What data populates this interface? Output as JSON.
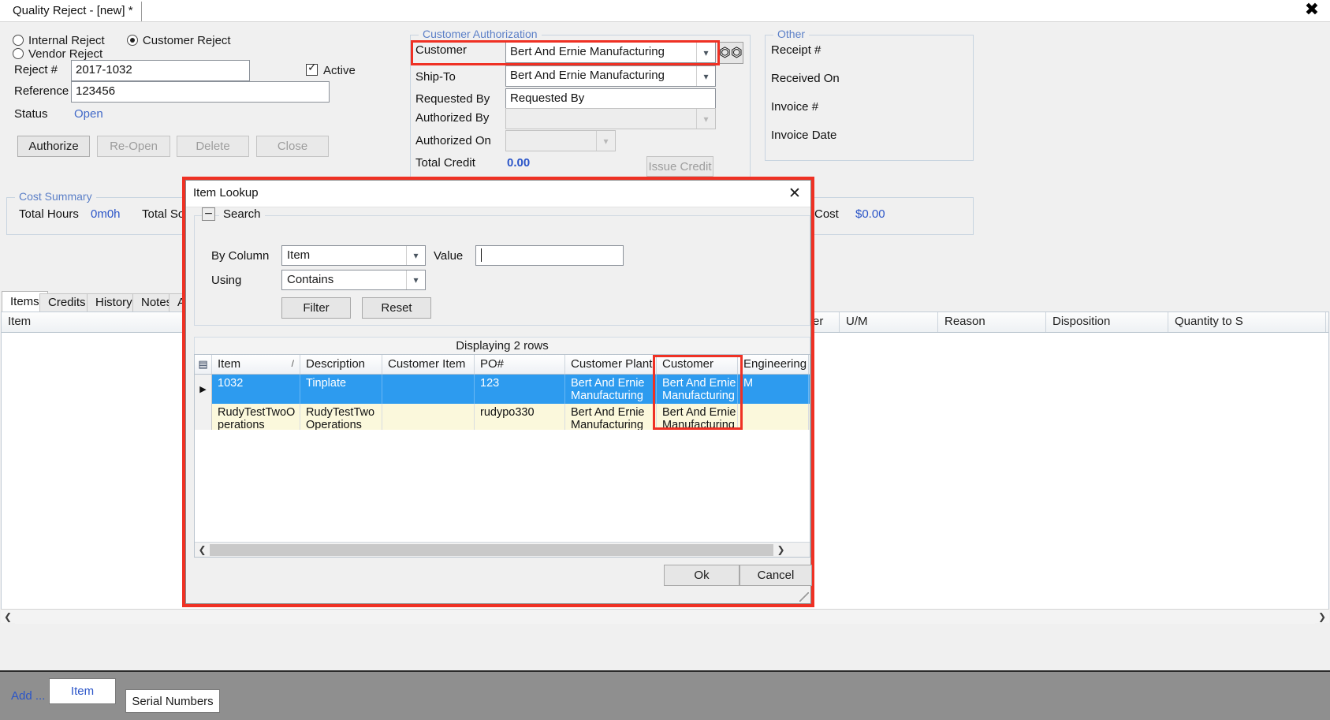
{
  "window": {
    "document_tab": "Quality Reject - [new] *",
    "close_label": "✖"
  },
  "reject_type": {
    "options": [
      {
        "label": "Internal Reject",
        "selected": false
      },
      {
        "label": "Customer Reject",
        "selected": true
      },
      {
        "label": "Vendor Reject",
        "selected": false
      }
    ]
  },
  "header_form": {
    "reject_number_label": "Reject #",
    "reject_number_value": "2017-1032",
    "reference_label": "Reference",
    "reference_value": "123456",
    "status_label": "Status",
    "status_value": "Open",
    "active_label": "Active"
  },
  "action_buttons": [
    {
      "label": "Authorize",
      "enabled": true
    },
    {
      "label": "Re-Open",
      "enabled": false
    },
    {
      "label": "Delete",
      "enabled": false
    },
    {
      "label": "Close",
      "enabled": false
    }
  ],
  "customer_authorization": {
    "title": "Customer Authorization",
    "customer_label": "Customer",
    "customer_value": "Bert And Ernie Manufacturing",
    "ship_to_label": "Ship-To",
    "ship_to_value": "Bert And Ernie Manufacturing",
    "requested_by_label": "Requested By",
    "requested_by_value": "Requested By",
    "authorized_by_label": "Authorized By",
    "authorized_by_value": "",
    "authorized_on_label": "Authorized On",
    "authorized_on_value": "",
    "total_credit_label": "Total Credit",
    "total_credit_value": "0.00",
    "issue_credit_label": "Issue Credit",
    "lookup_icon": "binoculars-icon"
  },
  "other": {
    "title": "Other",
    "fields": [
      "Receipt #",
      "Received On",
      "Invoice #",
      "Invoice Date"
    ]
  },
  "cost_summary": {
    "title": "Cost Summary",
    "total_hours_label": "Total Hours",
    "total_hours_value": "0m0h",
    "total_scrap_label": "Total Sc",
    "cost_label": "Cost",
    "cost_value": "$0.00"
  },
  "tabs": [
    {
      "label": "Items",
      "active": true
    },
    {
      "label": "Credits",
      "active": false
    },
    {
      "label": "History",
      "active": false
    },
    {
      "label": "Notes",
      "active": false
    },
    {
      "label": "Ad",
      "active": false
    }
  ],
  "main_grid": {
    "columns": [
      "Item",
      "er",
      "U/M",
      "Reason",
      "Disposition",
      "Quantity to S"
    ]
  },
  "bottom_bar": {
    "add_label": "Add ...",
    "item_label": "Item",
    "serial_numbers_label": "Serial Numbers"
  },
  "item_lookup": {
    "title": "Item Lookup",
    "close_label": "✕",
    "search": {
      "group_label": "Search",
      "collapse_icon": "−",
      "by_column_label": "By Column",
      "by_column_value": "Item",
      "value_label": "Value",
      "value_text": "",
      "using_label": "Using",
      "using_value": "Contains",
      "filter_label": "Filter",
      "reset_label": "Reset"
    },
    "row_count_text": "Displaying 2 rows",
    "grid": {
      "columns": [
        "Item",
        "Description",
        "Customer Item",
        "PO#",
        "Customer Plant",
        "Customer",
        "Engineering l"
      ],
      "sort_indicator": "/",
      "rows": [
        {
          "selected": true,
          "cells": [
            "1032",
            "Tinplate",
            "",
            "123",
            "Bert And Ernie Manufacturing",
            "Bert And Ernie Manufacturing",
            "M"
          ]
        },
        {
          "selected": false,
          "cells": [
            "RudyTestTwoOperations",
            "RudyTestTwoOperations",
            "",
            "rudypo330",
            "Bert And Ernie Manufacturing",
            "Bert And Ernie Manufacturing",
            ""
          ]
        }
      ]
    },
    "ok_label": "Ok",
    "cancel_label": "Cancel"
  },
  "colors": {
    "annotation": "#ef3124",
    "group_title": "#5b7fc7",
    "link": "#2b55c8",
    "row_selected": "#2d9bef",
    "row_alt": "#fbf8dc"
  }
}
